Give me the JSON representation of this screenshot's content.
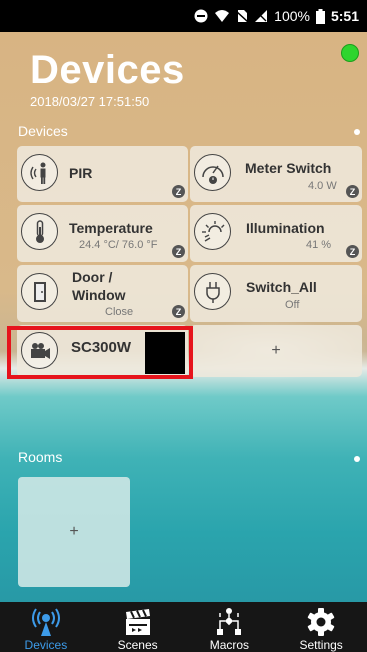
{
  "status_bar": {
    "battery": "100%",
    "time": "5:51"
  },
  "header": {
    "title": "Devices",
    "timestamp": "2018/03/27 17:51:50",
    "connection_color": "#2ed52e"
  },
  "devices_section": {
    "label": "Devices",
    "tiles": [
      {
        "name": "PIR",
        "value": "",
        "icon": "motion-sensor-icon",
        "zwave": true
      },
      {
        "name": "Meter Switch",
        "value": "4.0 W",
        "icon": "meter-gauge-icon",
        "zwave": true
      },
      {
        "name": "Temperature",
        "value": "24.4 °C/ 76.0 °F",
        "icon": "thermometer-icon",
        "zwave": true
      },
      {
        "name": "Illumination",
        "value": "41 %",
        "icon": "sun-icon",
        "zwave": true
      },
      {
        "name_line1": "Door /",
        "name_line2": "Window",
        "value": "Close",
        "icon": "door-icon",
        "zwave": true
      },
      {
        "name": "Switch_All",
        "value": "Off",
        "icon": "plug-icon",
        "zwave": false
      },
      {
        "name": "SC300W",
        "value": "",
        "icon": "camera-icon",
        "zwave": false
      }
    ],
    "add_label": "+",
    "zwave_badge": "Z"
  },
  "rooms_section": {
    "label": "Rooms",
    "add_label": "+"
  },
  "bottom_nav": [
    {
      "label": "Devices",
      "icon": "broadcast-icon",
      "active": true
    },
    {
      "label": "Scenes",
      "icon": "clapperboard-icon",
      "active": false
    },
    {
      "label": "Macros",
      "icon": "flowchart-icon",
      "active": false
    },
    {
      "label": "Settings",
      "icon": "gear-icon",
      "active": false
    }
  ],
  "colors": {
    "accent": "#3d9be9",
    "highlight": "#e6141c"
  }
}
